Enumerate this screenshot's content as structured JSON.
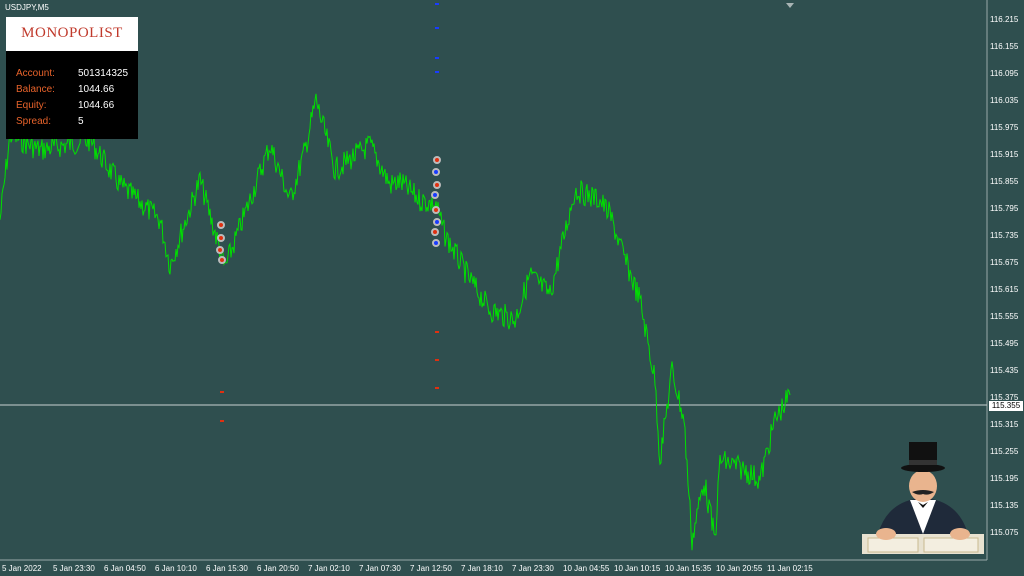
{
  "window": {
    "symbol": "USDJPY,M5"
  },
  "info_panel": {
    "logo": "MONOPOLIST",
    "rows": [
      {
        "label": "Account:",
        "value": "501314325"
      },
      {
        "label": "Balance:",
        "value": "1044.66"
      },
      {
        "label": "Equity:",
        "value": "1044.66"
      },
      {
        "label": "Spread:",
        "value": "5"
      }
    ]
  },
  "price_axis": {
    "ticks": [
      "116.215",
      "116.155",
      "116.095",
      "116.035",
      "115.975",
      "115.915",
      "115.855",
      "115.795",
      "115.735",
      "115.675",
      "115.615",
      "115.555",
      "115.495",
      "115.435",
      "115.375",
      "115.315",
      "115.255",
      "115.195",
      "115.135",
      "115.075"
    ],
    "current_price": "115.355"
  },
  "time_axis": {
    "ticks": [
      "5 Jan 2022",
      "5 Jan 23:30",
      "6 Jan 04:50",
      "6 Jan 10:10",
      "6 Jan 15:30",
      "6 Jan 20:50",
      "7 Jan 02:10",
      "7 Jan 07:30",
      "7 Jan 12:50",
      "7 Jan 18:10",
      "7 Jan 23:30",
      "10 Jan 04:55",
      "10 Jan 10:15",
      "10 Jan 15:35",
      "10 Jan 20:55",
      "11 Jan 02:15"
    ]
  },
  "colors": {
    "background": "#2f4f4f",
    "price_line": "#00e000",
    "grid": "#ffffff",
    "label_orange": "#e8632b",
    "sell_marker": "#e03010",
    "buy_marker": "#1a3cff"
  },
  "icons": {
    "mascot": "monopoly-man-icon"
  }
}
